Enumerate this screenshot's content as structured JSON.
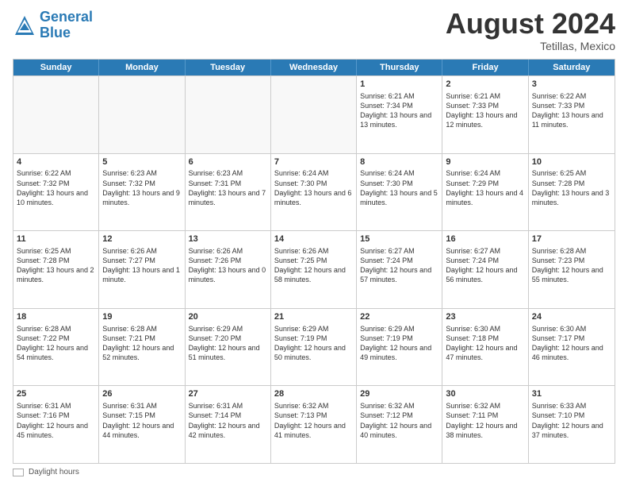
{
  "header": {
    "logo_line1": "General",
    "logo_line2": "Blue",
    "main_title": "August 2024",
    "subtitle": "Tetillas, Mexico"
  },
  "days_of_week": [
    "Sunday",
    "Monday",
    "Tuesday",
    "Wednesday",
    "Thursday",
    "Friday",
    "Saturday"
  ],
  "legend": {
    "label": "Daylight hours"
  },
  "weeks": [
    [
      {
        "day": "",
        "sunrise": "",
        "sunset": "",
        "daylight": "",
        "empty": true
      },
      {
        "day": "",
        "sunrise": "",
        "sunset": "",
        "daylight": "",
        "empty": true
      },
      {
        "day": "",
        "sunrise": "",
        "sunset": "",
        "daylight": "",
        "empty": true
      },
      {
        "day": "",
        "sunrise": "",
        "sunset": "",
        "daylight": "",
        "empty": true
      },
      {
        "day": "1",
        "sunrise": "Sunrise: 6:21 AM",
        "sunset": "Sunset: 7:34 PM",
        "daylight": "Daylight: 13 hours and 13 minutes.",
        "empty": false
      },
      {
        "day": "2",
        "sunrise": "Sunrise: 6:21 AM",
        "sunset": "Sunset: 7:33 PM",
        "daylight": "Daylight: 13 hours and 12 minutes.",
        "empty": false
      },
      {
        "day": "3",
        "sunrise": "Sunrise: 6:22 AM",
        "sunset": "Sunset: 7:33 PM",
        "daylight": "Daylight: 13 hours and 11 minutes.",
        "empty": false
      }
    ],
    [
      {
        "day": "4",
        "sunrise": "Sunrise: 6:22 AM",
        "sunset": "Sunset: 7:32 PM",
        "daylight": "Daylight: 13 hours and 10 minutes.",
        "empty": false
      },
      {
        "day": "5",
        "sunrise": "Sunrise: 6:23 AM",
        "sunset": "Sunset: 7:32 PM",
        "daylight": "Daylight: 13 hours and 9 minutes.",
        "empty": false
      },
      {
        "day": "6",
        "sunrise": "Sunrise: 6:23 AM",
        "sunset": "Sunset: 7:31 PM",
        "daylight": "Daylight: 13 hours and 7 minutes.",
        "empty": false
      },
      {
        "day": "7",
        "sunrise": "Sunrise: 6:24 AM",
        "sunset": "Sunset: 7:30 PM",
        "daylight": "Daylight: 13 hours and 6 minutes.",
        "empty": false
      },
      {
        "day": "8",
        "sunrise": "Sunrise: 6:24 AM",
        "sunset": "Sunset: 7:30 PM",
        "daylight": "Daylight: 13 hours and 5 minutes.",
        "empty": false
      },
      {
        "day": "9",
        "sunrise": "Sunrise: 6:24 AM",
        "sunset": "Sunset: 7:29 PM",
        "daylight": "Daylight: 13 hours and 4 minutes.",
        "empty": false
      },
      {
        "day": "10",
        "sunrise": "Sunrise: 6:25 AM",
        "sunset": "Sunset: 7:28 PM",
        "daylight": "Daylight: 13 hours and 3 minutes.",
        "empty": false
      }
    ],
    [
      {
        "day": "11",
        "sunrise": "Sunrise: 6:25 AM",
        "sunset": "Sunset: 7:28 PM",
        "daylight": "Daylight: 13 hours and 2 minutes.",
        "empty": false
      },
      {
        "day": "12",
        "sunrise": "Sunrise: 6:26 AM",
        "sunset": "Sunset: 7:27 PM",
        "daylight": "Daylight: 13 hours and 1 minute.",
        "empty": false
      },
      {
        "day": "13",
        "sunrise": "Sunrise: 6:26 AM",
        "sunset": "Sunset: 7:26 PM",
        "daylight": "Daylight: 13 hours and 0 minutes.",
        "empty": false
      },
      {
        "day": "14",
        "sunrise": "Sunrise: 6:26 AM",
        "sunset": "Sunset: 7:25 PM",
        "daylight": "Daylight: 12 hours and 58 minutes.",
        "empty": false
      },
      {
        "day": "15",
        "sunrise": "Sunrise: 6:27 AM",
        "sunset": "Sunset: 7:24 PM",
        "daylight": "Daylight: 12 hours and 57 minutes.",
        "empty": false
      },
      {
        "day": "16",
        "sunrise": "Sunrise: 6:27 AM",
        "sunset": "Sunset: 7:24 PM",
        "daylight": "Daylight: 12 hours and 56 minutes.",
        "empty": false
      },
      {
        "day": "17",
        "sunrise": "Sunrise: 6:28 AM",
        "sunset": "Sunset: 7:23 PM",
        "daylight": "Daylight: 12 hours and 55 minutes.",
        "empty": false
      }
    ],
    [
      {
        "day": "18",
        "sunrise": "Sunrise: 6:28 AM",
        "sunset": "Sunset: 7:22 PM",
        "daylight": "Daylight: 12 hours and 54 minutes.",
        "empty": false
      },
      {
        "day": "19",
        "sunrise": "Sunrise: 6:28 AM",
        "sunset": "Sunset: 7:21 PM",
        "daylight": "Daylight: 12 hours and 52 minutes.",
        "empty": false
      },
      {
        "day": "20",
        "sunrise": "Sunrise: 6:29 AM",
        "sunset": "Sunset: 7:20 PM",
        "daylight": "Daylight: 12 hours and 51 minutes.",
        "empty": false
      },
      {
        "day": "21",
        "sunrise": "Sunrise: 6:29 AM",
        "sunset": "Sunset: 7:19 PM",
        "daylight": "Daylight: 12 hours and 50 minutes.",
        "empty": false
      },
      {
        "day": "22",
        "sunrise": "Sunrise: 6:29 AM",
        "sunset": "Sunset: 7:19 PM",
        "daylight": "Daylight: 12 hours and 49 minutes.",
        "empty": false
      },
      {
        "day": "23",
        "sunrise": "Sunrise: 6:30 AM",
        "sunset": "Sunset: 7:18 PM",
        "daylight": "Daylight: 12 hours and 47 minutes.",
        "empty": false
      },
      {
        "day": "24",
        "sunrise": "Sunrise: 6:30 AM",
        "sunset": "Sunset: 7:17 PM",
        "daylight": "Daylight: 12 hours and 46 minutes.",
        "empty": false
      }
    ],
    [
      {
        "day": "25",
        "sunrise": "Sunrise: 6:31 AM",
        "sunset": "Sunset: 7:16 PM",
        "daylight": "Daylight: 12 hours and 45 minutes.",
        "empty": false
      },
      {
        "day": "26",
        "sunrise": "Sunrise: 6:31 AM",
        "sunset": "Sunset: 7:15 PM",
        "daylight": "Daylight: 12 hours and 44 minutes.",
        "empty": false
      },
      {
        "day": "27",
        "sunrise": "Sunrise: 6:31 AM",
        "sunset": "Sunset: 7:14 PM",
        "daylight": "Daylight: 12 hours and 42 minutes.",
        "empty": false
      },
      {
        "day": "28",
        "sunrise": "Sunrise: 6:32 AM",
        "sunset": "Sunset: 7:13 PM",
        "daylight": "Daylight: 12 hours and 41 minutes.",
        "empty": false
      },
      {
        "day": "29",
        "sunrise": "Sunrise: 6:32 AM",
        "sunset": "Sunset: 7:12 PM",
        "daylight": "Daylight: 12 hours and 40 minutes.",
        "empty": false
      },
      {
        "day": "30",
        "sunrise": "Sunrise: 6:32 AM",
        "sunset": "Sunset: 7:11 PM",
        "daylight": "Daylight: 12 hours and 38 minutes.",
        "empty": false
      },
      {
        "day": "31",
        "sunrise": "Sunrise: 6:33 AM",
        "sunset": "Sunset: 7:10 PM",
        "daylight": "Daylight: 12 hours and 37 minutes.",
        "empty": false
      }
    ]
  ]
}
